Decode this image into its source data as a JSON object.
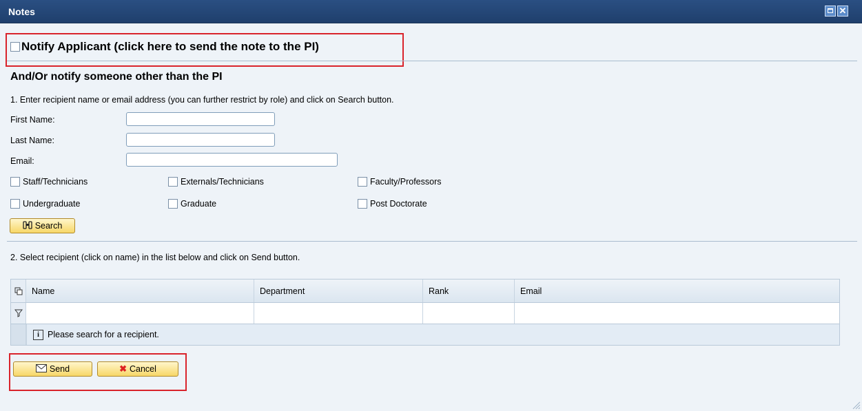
{
  "window": {
    "title": "Notes"
  },
  "notify": {
    "label": "Notify Applicant (click here to send the note to the PI)"
  },
  "other": {
    "title": "And/Or notify someone other than the PI",
    "step1": "1. Enter recipient name or email address (you can further restrict by role) and click on Search button.",
    "first_name_label": "First Name:",
    "last_name_label": "Last Name:",
    "email_label": "Email:",
    "first_name_value": "",
    "last_name_value": "",
    "email_value": "",
    "roles": [
      "Staff/Technicians",
      "Externals/Technicians",
      "Faculty/Professors",
      "Undergraduate",
      "Graduate",
      "Post Doctorate"
    ],
    "search_label": "Search",
    "step2": "2. Select recipient (click on name) in the list below and click on Send button."
  },
  "table": {
    "columns": [
      "Name",
      "Department",
      "Rank",
      "Email"
    ],
    "empty_message": "Please search for a recipient."
  },
  "actions": {
    "send_label": "Send",
    "cancel_label": "Cancel"
  },
  "colors": {
    "titlebar": "#1f3f6c",
    "highlight": "#d9232b",
    "button": "#f7d768"
  },
  "icons": {
    "search": "binoculars-icon",
    "send": "envelope-icon",
    "cancel": "red-x-icon",
    "info": "info-icon",
    "filter": "filter-icon",
    "select_all": "select-all-icon"
  }
}
